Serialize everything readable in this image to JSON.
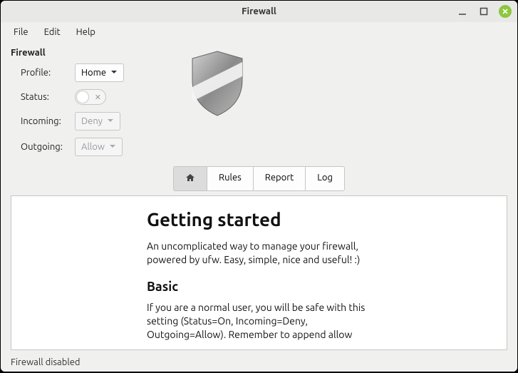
{
  "window": {
    "title": "Firewall"
  },
  "menu": {
    "file": "File",
    "edit": "Edit",
    "help": "Help"
  },
  "section": {
    "title": "Firewall"
  },
  "form": {
    "profile_label": "Profile:",
    "profile_value": "Home",
    "status_label": "Status:",
    "incoming_label": "Incoming:",
    "incoming_value": "Deny",
    "outgoing_label": "Outgoing:",
    "outgoing_value": "Allow"
  },
  "tabs": {
    "home": "⌂",
    "rules": "Rules",
    "report": "Report",
    "log": "Log"
  },
  "doc": {
    "h1": "Getting started",
    "p1": "An uncomplicated way to manage your firewall, powered by ufw. Easy, simple, nice and useful! :)",
    "h2": "Basic",
    "p2": "If you are a normal user, you will be safe with this setting (Status=On, Incoming=Deny, Outgoing=Allow). Remember to append allow"
  },
  "status": {
    "text": "Firewall disabled"
  },
  "colors": {
    "close": "#8cc73f"
  }
}
